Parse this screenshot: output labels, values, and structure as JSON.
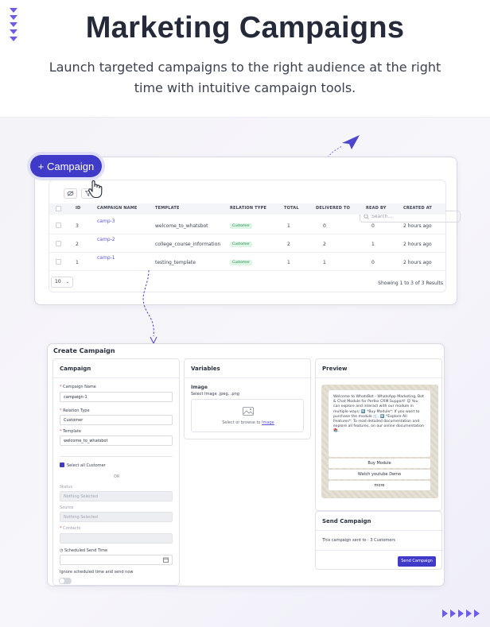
{
  "hero": {
    "title": "Marketing Campaigns",
    "subtitle": "Launch targeted campaigns to the right audience at the right time with intuitive campaign tools."
  },
  "colors": {
    "accent": "#3f3bc8",
    "brand_purple": "#6c5ce7",
    "badge_green": "#1e8a4a"
  },
  "campaign_list": {
    "add_button_label": "+ Campaign",
    "search_placeholder": "Search...",
    "columns": [
      "ID",
      "CAMPAIGN NAME",
      "TEMPLATE",
      "RELATION TYPE",
      "TOTAL",
      "DELIVERED TO",
      "READ BY",
      "CREATED AT"
    ],
    "rows": [
      {
        "id": "3",
        "name": "camp-3",
        "template": "welcome_to_whatsbot",
        "relation": "Customer",
        "total": "1",
        "delivered": "0",
        "read": "0",
        "created": "2 hours ago"
      },
      {
        "id": "2",
        "name": "camp-2",
        "template": "college_course_information",
        "relation": "Customer",
        "total": "2",
        "delivered": "2",
        "read": "1",
        "created": "2 hours ago"
      },
      {
        "id": "1",
        "name": "camp-1",
        "template": "testing_template",
        "relation": "Customer",
        "total": "1",
        "delivered": "1",
        "read": "0",
        "created": "2 hours ago"
      }
    ],
    "page_size": "10",
    "showing_text": "Showing 1 to 3 of 3 Results"
  },
  "create_campaign": {
    "title": "Create Campaign",
    "campaign_panel": {
      "heading": "Campaign",
      "name_label": "Campaign Name",
      "name_value": "campaign-1",
      "relation_label": "Relation Type",
      "relation_value": "Customer",
      "template_label": "Template",
      "template_value": "welcome_to_whatsbot",
      "select_all_label": "Select all Customer",
      "or_label": "OR",
      "status_label": "Status",
      "status_placeholder": "Nothing Selected",
      "source_label": "Source",
      "source_placeholder": "Nothing Selected",
      "contacts_label": "Contacts",
      "scheduled_label": "Scheduled Send Time",
      "ignore_label": "Ignore scheduled time and send now"
    },
    "variables_panel": {
      "heading": "Variables",
      "image_label": "Image",
      "image_hint": "Select Image .jpeg, .png",
      "upload_text": "Select or browse to",
      "upload_link": "Image"
    },
    "preview_panel": {
      "heading": "Preview",
      "message": "Welcome to WhatsBot - WhatsApp Marketing, Bot & Chat Module for Perfex CRM Support! 😊 You can explore and interact with our module in multiple ways: 1️⃣ *Buy Module*: If you want to purchase the module 🛒, 2️⃣ *Explore All Features*: To read detailed documentation and explore all features, on our online documentation 📚.",
      "buttons": [
        "Buy Module",
        "Watch youtube Demo",
        "more"
      ]
    },
    "send_panel": {
      "heading": "Send Campaign",
      "info": "This campaign sent to : 3 Customers",
      "button": "Send Campaign"
    }
  }
}
